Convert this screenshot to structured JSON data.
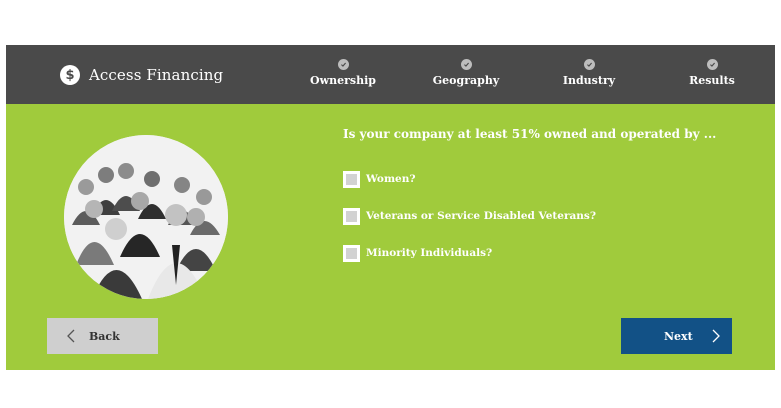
{
  "header": {
    "title": "Access Financing",
    "logo_glyph": "$",
    "steps": [
      {
        "label": "Ownership",
        "icon": "check-icon"
      },
      {
        "label": "Geography",
        "icon": "check-icon"
      },
      {
        "label": "Industry",
        "icon": "check-icon"
      },
      {
        "label": "Results",
        "icon": "check-icon"
      }
    ]
  },
  "main": {
    "question": "Is your company at least 51% owned and operated by ...",
    "options": [
      {
        "label": "Women?",
        "checked": false
      },
      {
        "label": "Veterans or Service Disabled Veterans?",
        "checked": false
      },
      {
        "label": "Minority Individuals?",
        "checked": false
      }
    ]
  },
  "nav": {
    "back_label": "Back",
    "next_label": "Next"
  },
  "colors": {
    "header_bg": "#4a4a4a",
    "content_bg": "#a0cb3c",
    "next_button": "#125186",
    "back_button": "#cfcfcf"
  }
}
